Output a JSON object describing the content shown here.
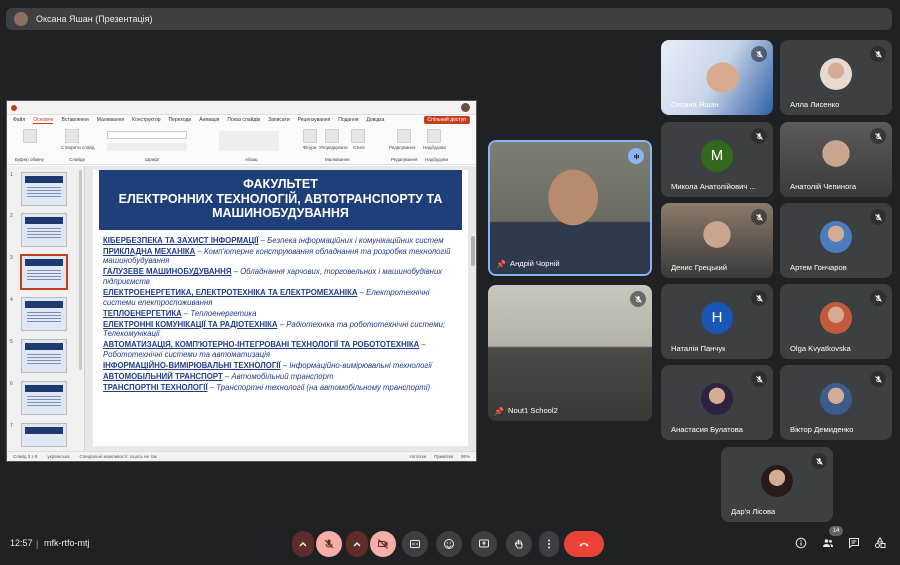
{
  "presenter_bar": {
    "text": "Оксана Яшан (Презентація)"
  },
  "ppt": {
    "tabs": [
      "Файл",
      "Основне",
      "Вставлення",
      "Малювання",
      "Конструктор",
      "Переходи",
      "Анімація",
      "Показ слайдів",
      "Записати",
      "Рецензування",
      "Подання",
      "Довідка"
    ],
    "active_tab": "Основне",
    "share_label": "Спільний доступ",
    "ribbon_labels": [
      "Буфер обміну",
      "Слайди",
      "Шрифт",
      "Абзац",
      "Малювання",
      "Редагування",
      "Надбудови"
    ],
    "ribbon_buttons": [
      "Створити слайд",
      "Фігури",
      "Упорядкувати",
      "Стилі",
      "Редагування",
      "Надбудови"
    ],
    "slide_numbers": [
      "1",
      "2",
      "3",
      "4",
      "5",
      "6",
      "7"
    ],
    "status": {
      "slide": "Слайд 3 з 9",
      "lang": "українська",
      "access": "Спеціальні можливості: сщось не так",
      "notes": "Нотатки",
      "comments": "Примітки",
      "zoom": "95%"
    }
  },
  "slide": {
    "title": "ФАКУЛЬТЕТ\nЕЛЕКТРОННИХ ТЕХНОЛОГІЙ, АВТОТРАНСПОРТУ ТА МАШИНОБУДУВАННЯ",
    "items": [
      {
        "k": "КІБЕРБЕЗПЕКА ТА ЗАХИСТ ІНФОРМАЦІЇ",
        "d": "Безпека інформаційних і комунікаційних систем"
      },
      {
        "k": "ПРИКЛАДНА МЕХАНІКА",
        "d": "Комп'ютерне конструювання обладнання та розробка технологій машинобудування"
      },
      {
        "k": "ГАЛУЗЕВЕ МАШИНОБУДУВАННЯ",
        "d": "Обладнання харчових, торговельних і машинобудівних підприємств"
      },
      {
        "k": "ЕЛЕКТРОЕНЕРГЕТИКА, ЕЛЕКТРОТЕХНІКА ТА ЕЛЕКТРОМЕХАНІКА",
        "d": "Електротехнічні системи електроспоживання"
      },
      {
        "k": "ТЕПЛОЕНЕРГЕТИКА",
        "d": "Теплоенергетика"
      },
      {
        "k": "ЕЛЕКТРОННІ КОМУНІКАЦІЇ ТА РАДІОТЕХНІКА",
        "d": "Радіотехніка та робототехнічні системи; Телекомунікації"
      },
      {
        "k": "АВТОМАТИЗАЦІЯ, КОМП'ЮТЕРНО-ІНТЕГРОВАНІ ТЕХНОЛОГІЇ ТА РОБОТОТЕХНІКА",
        "d": "Робототехнічні системи та автоматизація"
      },
      {
        "k": "ІНФОРМАЦІЙНО-ВИМІРЮВАЛЬНІ ТЕХНОЛОГІЇ",
        "d": "Інформаційно-вимірювальні технології"
      },
      {
        "k": "АВТОМОБІЛЬНИЙ ТРАНСПОРТ",
        "d": "Автомобільний транспорт"
      },
      {
        "k": "ТРАНСПОРТНІ ТЕХНОЛОГІЇ",
        "d": "Транспортні технології (на автомобільному транспорті)"
      }
    ]
  },
  "participants": [
    {
      "name": "Оксана Яшан",
      "kind": "photo",
      "color": "#c9d6e8"
    },
    {
      "name": "Алла Лисенко",
      "kind": "avatar-photo",
      "color": "#e8d9d0"
    },
    {
      "name": "Андрій Чорній",
      "kind": "video",
      "color": "#6d6f66"
    },
    {
      "name": "Микола Анатолійович ...",
      "kind": "letter",
      "letter": "M",
      "color": "#33691e"
    },
    {
      "name": "Анатолій Чепинога",
      "kind": "photo",
      "color": "#5a5a5a"
    },
    {
      "name": "Денис Грецький",
      "kind": "photo",
      "color": "#8b7a6a"
    },
    {
      "name": "Артем Гончаров",
      "kind": "avatar-photo",
      "color": "#4a7cc0"
    },
    {
      "name": "Nout1 School2",
      "kind": "video",
      "color": "#7b7b6e"
    },
    {
      "name": "Наталія Панчук",
      "kind": "letter",
      "letter": "H",
      "color": "#1a56b8"
    },
    {
      "name": "Olga Kvyatkovska",
      "kind": "avatar-photo",
      "color": "#c25a3b"
    },
    {
      "name": "Анастасия Булатова",
      "kind": "avatar-photo",
      "color": "#2d2240"
    },
    {
      "name": "Віктор Демиденко",
      "kind": "avatar-photo",
      "color": "#3b5c8c"
    },
    {
      "name": "Дар'я Лісова",
      "kind": "avatar-photo",
      "color": "#2a1a1a"
    }
  ],
  "meeting": {
    "time": "12:57",
    "separator": "|",
    "code": "mfk-rtfo-mtj",
    "participant_count": "14"
  },
  "colors": {
    "end_call": "#ea4335",
    "muted": "#f28b82",
    "accent": "#8ab4f8"
  }
}
